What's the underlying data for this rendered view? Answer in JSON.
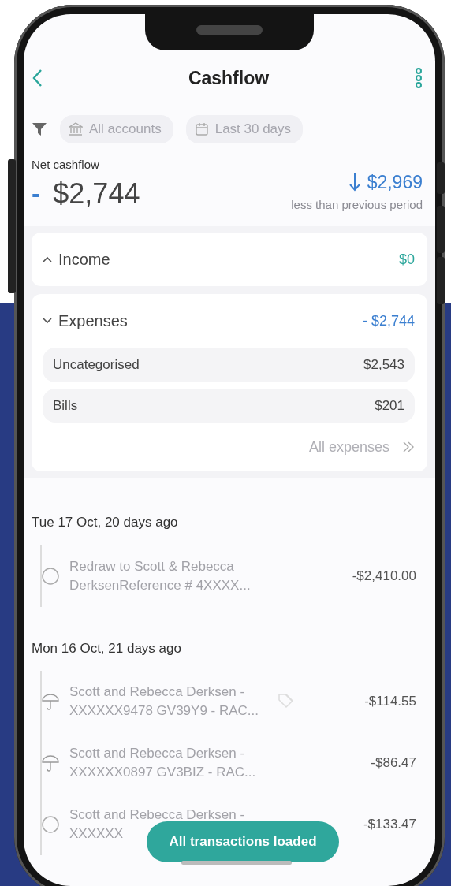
{
  "header": {
    "title": "Cashflow"
  },
  "filters": [
    {
      "kind": "bank",
      "label": "All accounts"
    },
    {
      "kind": "calendar",
      "label": "Last 30 days"
    }
  ],
  "summary": {
    "label": "Net cashflow",
    "sign": "-",
    "value": "$2,744",
    "change": "$2,969",
    "change_note": "less than previous period"
  },
  "sections": [
    {
      "title": "Income",
      "amount": "$0",
      "color": "#2ba69b",
      "expanded": false
    },
    {
      "title": "Expenses",
      "amount": "- $2,744",
      "color": "#3b7fd0",
      "expanded": true,
      "items": [
        {
          "name": "Uncategorised",
          "amount": "$2,543"
        },
        {
          "name": "Bills",
          "amount": "$201"
        }
      ],
      "link": "All expenses"
    }
  ],
  "days": [
    {
      "date": "Tue 17 Oct, 20 days ago",
      "transactions": [
        {
          "kind": "circle",
          "lines": [
            "Redraw to Scott & Rebecca",
            "DerksenReference # 4XXXX..."
          ],
          "tagged": false,
          "amount": "-$2,410.00"
        }
      ]
    },
    {
      "date": "Mon 16 Oct, 21 days ago",
      "transactions": [
        {
          "kind": "umbrella",
          "lines": [
            "Scott and Rebecca Derksen -",
            "XXXXXX9478 GV39Y9 - RAC..."
          ],
          "tagged": true,
          "amount": "-$114.55"
        },
        {
          "kind": "umbrella",
          "lines": [
            "Scott and Rebecca Derksen -",
            "XXXXXX0897 GV3BIZ - RAC..."
          ],
          "tagged": false,
          "amount": "-$86.47"
        },
        {
          "kind": "circle",
          "lines": [
            "Scott and Rebecca Derksen -",
            "XXXXXX"
          ],
          "tagged": false,
          "amount": "-$133.47"
        }
      ]
    }
  ],
  "toast": "All transactions loaded"
}
